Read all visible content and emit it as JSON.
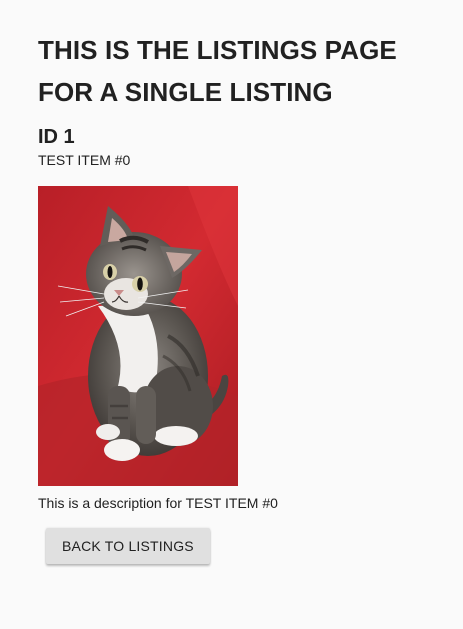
{
  "page": {
    "title": "THIS IS THE LISTINGS PAGE FOR A SINGLE LISTING"
  },
  "listing": {
    "id_label": "ID 1",
    "name": "TEST ITEM #0",
    "description": "This is a description for TEST ITEM #0",
    "photo": {
      "subject": "kitten",
      "background_color": "#c8242b"
    }
  },
  "actions": {
    "back_label": "BACK TO LISTINGS"
  }
}
